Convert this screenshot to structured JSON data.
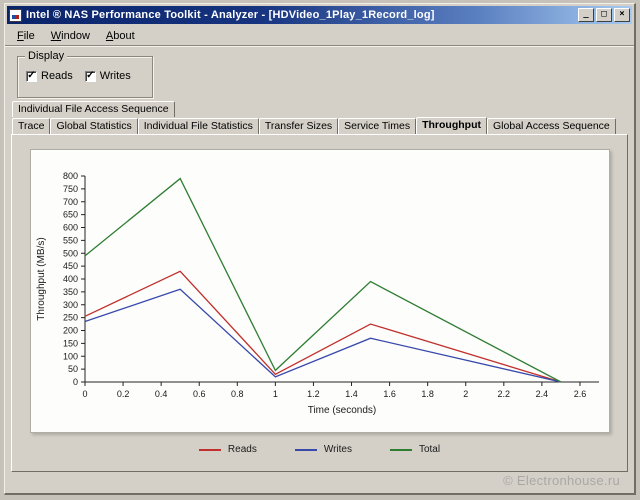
{
  "window": {
    "title": "Intel ® NAS Performance Toolkit - Analyzer - [HDVideo_1Play_1Record_log]",
    "controls": {
      "minimize": "_",
      "maximize": "□",
      "close": "×"
    }
  },
  "menu": {
    "items": [
      "File",
      "Window",
      "About"
    ]
  },
  "display_group": {
    "label": "Display",
    "check_glyph": "✓",
    "checkboxes": [
      {
        "label": "Reads",
        "checked": true
      },
      {
        "label": "Writes",
        "checked": true
      }
    ]
  },
  "tabs": {
    "row1": [
      "Individual File Access Sequence"
    ],
    "row2": [
      "Trace",
      "Global Statistics",
      "Individual File Statistics",
      "Transfer Sizes",
      "Service Times",
      "Throughput",
      "Global Access Sequence"
    ],
    "selected": "Throughput"
  },
  "chart_data": {
    "type": "line",
    "title": "",
    "xlabel": "Time (seconds)",
    "ylabel": "Throughput (MB/s)",
    "xlim": [
      0,
      2.7
    ],
    "ylim": [
      0,
      800
    ],
    "x_ticks": [
      0,
      0.2,
      0.4,
      0.6,
      0.8,
      1.0,
      1.2,
      1.4,
      1.6,
      1.8,
      2.0,
      2.2,
      2.4,
      2.6
    ],
    "x_tick_labels": [
      "0",
      "0.2",
      "0.4",
      "0.6",
      "0.8",
      "1",
      "1.2",
      "1.4",
      "1.6",
      "1.8",
      "2",
      "2.2",
      "2.4",
      "2.6"
    ],
    "y_ticks": [
      0,
      50,
      100,
      150,
      200,
      250,
      300,
      350,
      400,
      450,
      500,
      550,
      600,
      650,
      700,
      750,
      800
    ],
    "x": [
      0,
      0.5,
      1.0,
      1.5,
      2.5
    ],
    "series": [
      {
        "name": "Reads",
        "color": "#c0302c",
        "values": [
          255,
          430,
          30,
          225,
          0
        ]
      },
      {
        "name": "Writes",
        "color": "#3949ab",
        "values": [
          235,
          360,
          20,
          170,
          0
        ]
      },
      {
        "name": "Total",
        "color": "#2f7d32",
        "values": [
          490,
          790,
          45,
          390,
          0
        ]
      }
    ],
    "legend_position": "bottom",
    "grid": false
  },
  "watermark": "© Electronhouse.ru"
}
